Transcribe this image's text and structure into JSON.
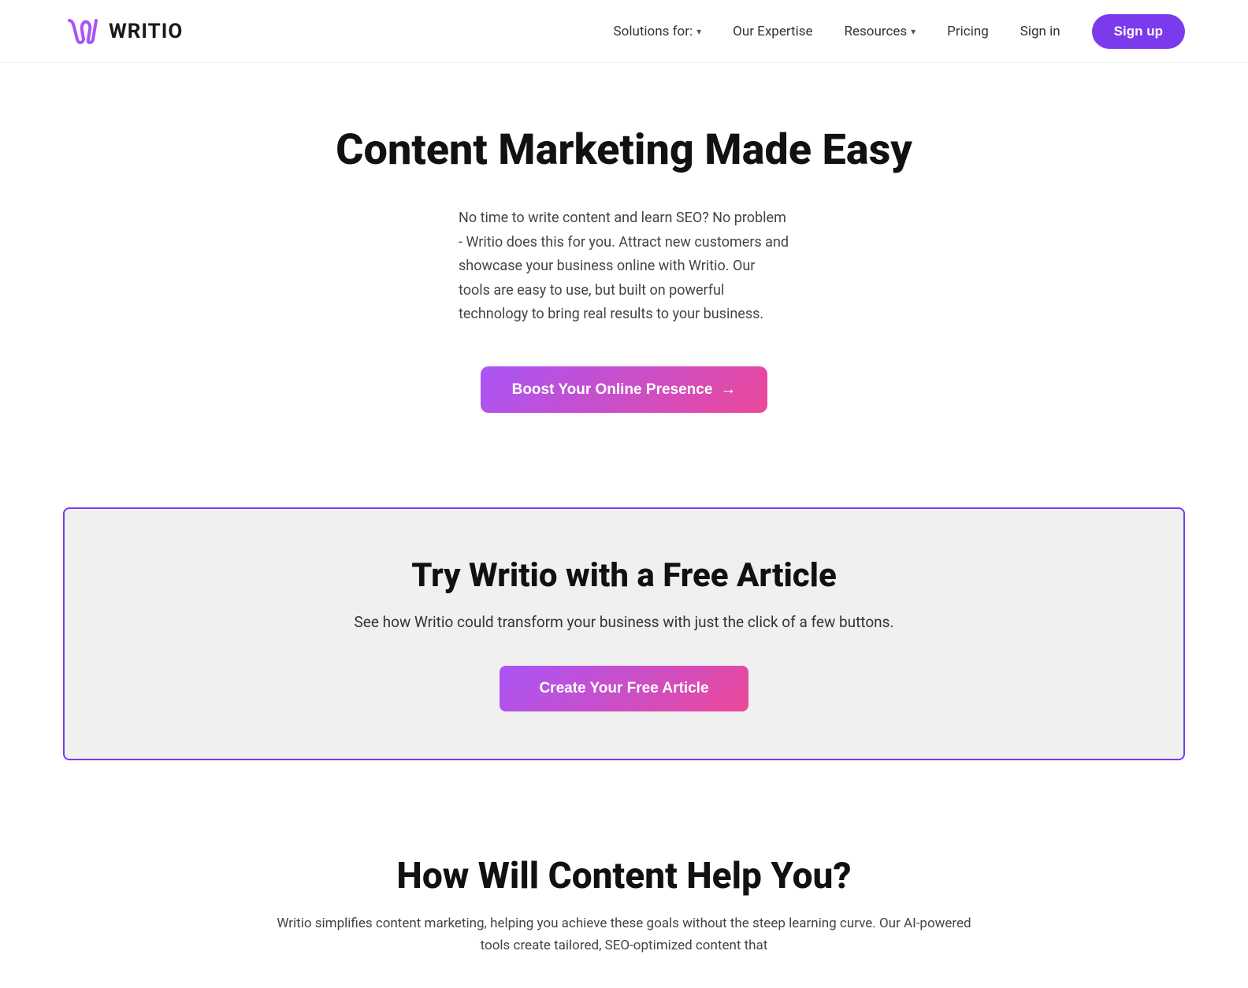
{
  "nav": {
    "logo_text": "WRITIO",
    "links": [
      {
        "label": "Solutions for:",
        "has_dropdown": true
      },
      {
        "label": "Our Expertise",
        "has_dropdown": false
      },
      {
        "label": "Resources",
        "has_dropdown": true
      },
      {
        "label": "Pricing",
        "has_dropdown": false
      }
    ],
    "signin_label": "Sign in",
    "signup_label": "Sign up"
  },
  "hero": {
    "title": "Content Marketing Made Easy",
    "description": "No time to write content and learn SEO? No problem - Writio does this for you. Attract new customers and showcase your business online with Writio. Our tools are easy to use, but built on powerful technology to bring real results to your business.",
    "boost_button_label": "Boost Your Online Presence",
    "boost_button_arrow": "→"
  },
  "try_section": {
    "title": "Try Writio with a Free Article",
    "description": "See how Writio could transform your business with just the click of a few buttons.",
    "create_button_label": "Create Your Free Article"
  },
  "how_section": {
    "title": "How Will Content Help You?",
    "description": "Writio simplifies content marketing, helping you achieve these goals without the steep learning curve. Our AI-powered tools create tailored, SEO-optimized content that"
  },
  "colors": {
    "brand_purple": "#7c3aed",
    "gradient_start": "#a855f7",
    "gradient_end": "#ec4899"
  }
}
